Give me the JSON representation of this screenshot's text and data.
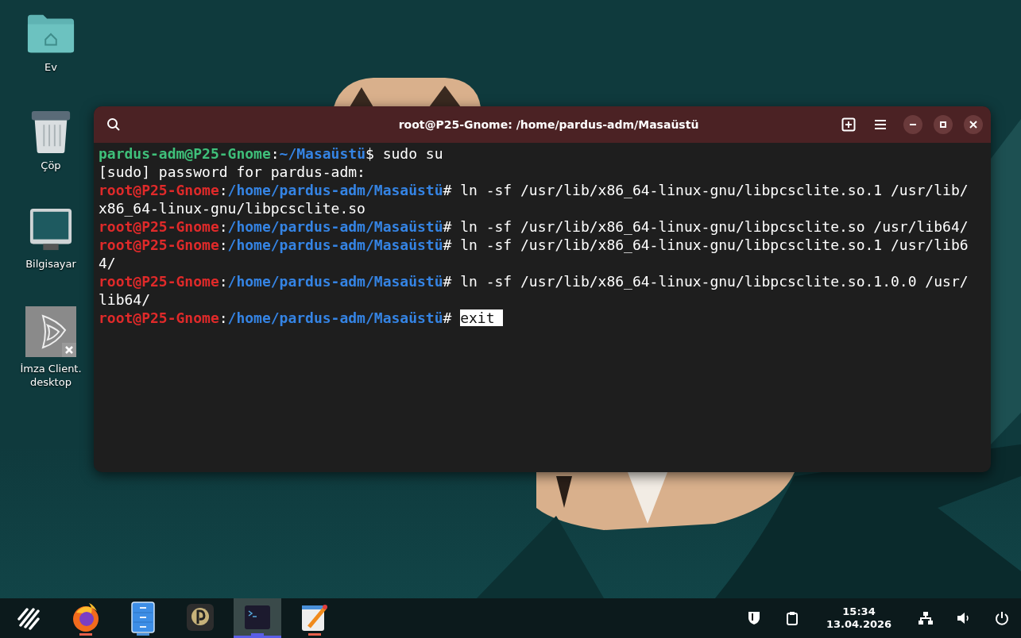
{
  "desktop_icons": [
    {
      "kind": "home-folder",
      "label": "Ev"
    },
    {
      "kind": "trash",
      "label": "Çöp"
    },
    {
      "kind": "computer",
      "label": "Bilgisayar"
    },
    {
      "kind": "broken-launcher",
      "label": "İmza Client.\ndesktop"
    }
  ],
  "terminal": {
    "title": "root@P25-Gnome: /home/pardus-adm/Masaüstü",
    "lines": [
      [
        {
          "kind": "user",
          "text": "pardus-adm@P25-Gnome"
        },
        {
          "kind": "plain",
          "text": ":"
        },
        {
          "kind": "path",
          "text": "~/Masaüstü"
        },
        {
          "kind": "plain",
          "text": "$ sudo su"
        }
      ],
      [
        {
          "kind": "plain",
          "text": "[sudo] password for pardus-adm:"
        }
      ],
      [
        {
          "kind": "root",
          "text": "root@P25-Gnome"
        },
        {
          "kind": "plain",
          "text": ":"
        },
        {
          "kind": "path",
          "text": "/home/pardus-adm/Masaüstü"
        },
        {
          "kind": "plain",
          "text": "# ln -sf /usr/lib/x86_64-linux-gnu/libpcsclite.so.1 /usr/lib/"
        }
      ],
      [
        {
          "kind": "plain",
          "text": "x86_64-linux-gnu/libpcsclite.so"
        }
      ],
      [
        {
          "kind": "root",
          "text": "root@P25-Gnome"
        },
        {
          "kind": "plain",
          "text": ":"
        },
        {
          "kind": "path",
          "text": "/home/pardus-adm/Masaüstü"
        },
        {
          "kind": "plain",
          "text": "# ln -sf /usr/lib/x86_64-linux-gnu/libpcsclite.so /usr/lib64/"
        }
      ],
      [
        {
          "kind": "root",
          "text": "root@P25-Gnome"
        },
        {
          "kind": "plain",
          "text": ":"
        },
        {
          "kind": "path",
          "text": "/home/pardus-adm/Masaüstü"
        },
        {
          "kind": "plain",
          "text": "# ln -sf /usr/lib/x86_64-linux-gnu/libpcsclite.so.1 /usr/lib6"
        }
      ],
      [
        {
          "kind": "plain",
          "text": "4/"
        }
      ],
      [
        {
          "kind": "root",
          "text": "root@P25-Gnome"
        },
        {
          "kind": "plain",
          "text": ":"
        },
        {
          "kind": "path",
          "text": "/home/pardus-adm/Masaüstü"
        },
        {
          "kind": "plain",
          "text": "# ln -sf /usr/lib/x86_64-linux-gnu/libpcsclite.so.1.0.0 /usr/"
        }
      ],
      [
        {
          "kind": "plain",
          "text": "lib64/"
        }
      ],
      [
        {
          "kind": "root",
          "text": "root@P25-Gnome"
        },
        {
          "kind": "plain",
          "text": ":"
        },
        {
          "kind": "path",
          "text": "/home/pardus-adm/Masaüstü"
        },
        {
          "kind": "plain",
          "text": "# "
        },
        {
          "kind": "selection",
          "text": "exit "
        }
      ]
    ]
  },
  "taskbar": {
    "apps": [
      {
        "kind": "firefox",
        "selected": false,
        "color": "#e8604c"
      },
      {
        "kind": "files",
        "selected": false,
        "color": "#4a90d9"
      },
      {
        "kind": "pardus",
        "selected": false
      },
      {
        "kind": "terminal",
        "selected": true,
        "color": "#5a5ee6"
      },
      {
        "kind": "editor",
        "selected": false,
        "color": "#e8604c"
      }
    ],
    "time": "15:34",
    "date": "13.04.2026"
  }
}
